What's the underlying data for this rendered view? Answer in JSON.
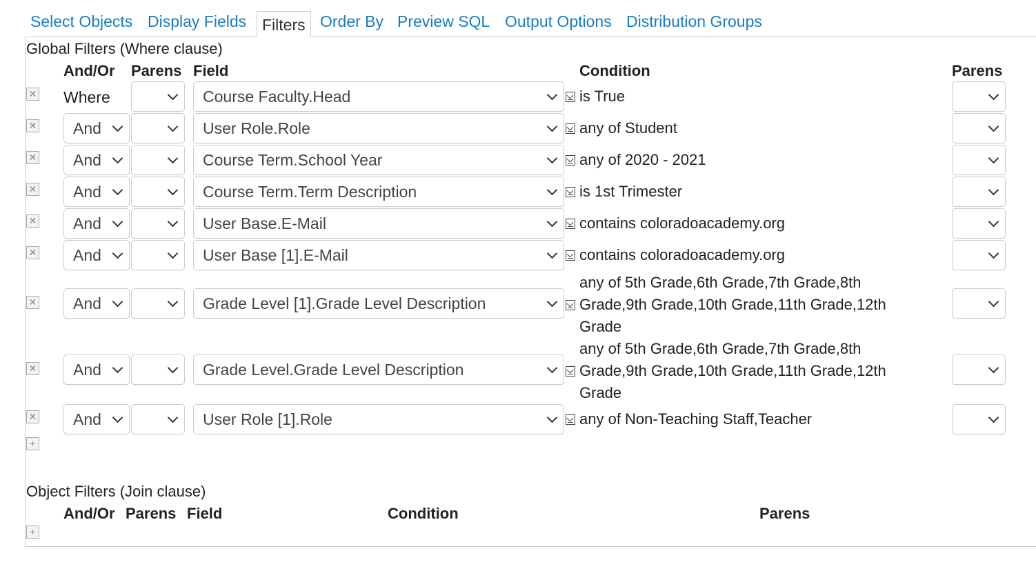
{
  "tabs": [
    {
      "label": "Select Objects",
      "active": false
    },
    {
      "label": "Display Fields",
      "active": false
    },
    {
      "label": "Filters",
      "active": true
    },
    {
      "label": "Order By",
      "active": false
    },
    {
      "label": "Preview SQL",
      "active": false
    },
    {
      "label": "Output Options",
      "active": false
    },
    {
      "label": "Distribution Groups",
      "active": false
    }
  ],
  "global_filters": {
    "title": "Global Filters (Where clause)",
    "headers": {
      "andor": "And/Or",
      "parens": "Parens",
      "field": "Field",
      "condition": "Condition",
      "parens_close": "Parens"
    },
    "rows": [
      {
        "andor": "Where",
        "andor_is_select": false,
        "open_paren": "",
        "field": "Course Faculty.Head",
        "condition": "is True",
        "close_paren": ""
      },
      {
        "andor": "And",
        "andor_is_select": true,
        "open_paren": "",
        "field": "User Role.Role",
        "condition": "any of Student",
        "close_paren": ""
      },
      {
        "andor": "And",
        "andor_is_select": true,
        "open_paren": "",
        "field": "Course Term.School Year",
        "condition": "any of 2020 - 2021",
        "close_paren": ""
      },
      {
        "andor": "And",
        "andor_is_select": true,
        "open_paren": "",
        "field": "Course Term.Term Description",
        "condition": "is 1st Trimester",
        "close_paren": ""
      },
      {
        "andor": "And",
        "andor_is_select": true,
        "open_paren": "",
        "field": "User Base.E-Mail",
        "condition": "contains coloradoacademy.org",
        "close_paren": ""
      },
      {
        "andor": "And",
        "andor_is_select": true,
        "open_paren": "",
        "field": "User Base [1].E-Mail",
        "condition": "contains coloradoacademy.org",
        "close_paren": ""
      },
      {
        "andor": "And",
        "andor_is_select": true,
        "open_paren": "",
        "field": "Grade Level [1].Grade Level Description",
        "condition": "any of 5th Grade,6th Grade,7th Grade,8th Grade,9th Grade,10th Grade,11th Grade,12th Grade",
        "close_paren": ""
      },
      {
        "andor": "And",
        "andor_is_select": true,
        "open_paren": "",
        "field": "Grade Level.Grade Level Description",
        "condition": "any of 5th Grade,6th Grade,7th Grade,8th Grade,9th Grade,10th Grade,11th Grade,12th Grade",
        "close_paren": ""
      },
      {
        "andor": "And",
        "andor_is_select": true,
        "open_paren": "",
        "field": "User Role [1].Role",
        "condition": "any of Non-Teaching Staff,Teacher",
        "close_paren": ""
      }
    ]
  },
  "object_filters": {
    "title": "Object Filters (Join clause)",
    "headers": {
      "andor": "And/Or",
      "parens": "Parens",
      "field": "Field",
      "condition": "Condition",
      "parens_close": "Parens"
    }
  },
  "icons": {
    "delete": "close-box-icon",
    "add": "plus-box-icon",
    "condition_edit": "condition-edit-icon",
    "dropdown": "chevron-down-icon"
  },
  "colors": {
    "tab_link": "#1a7bc4",
    "border": "#cccccc"
  }
}
